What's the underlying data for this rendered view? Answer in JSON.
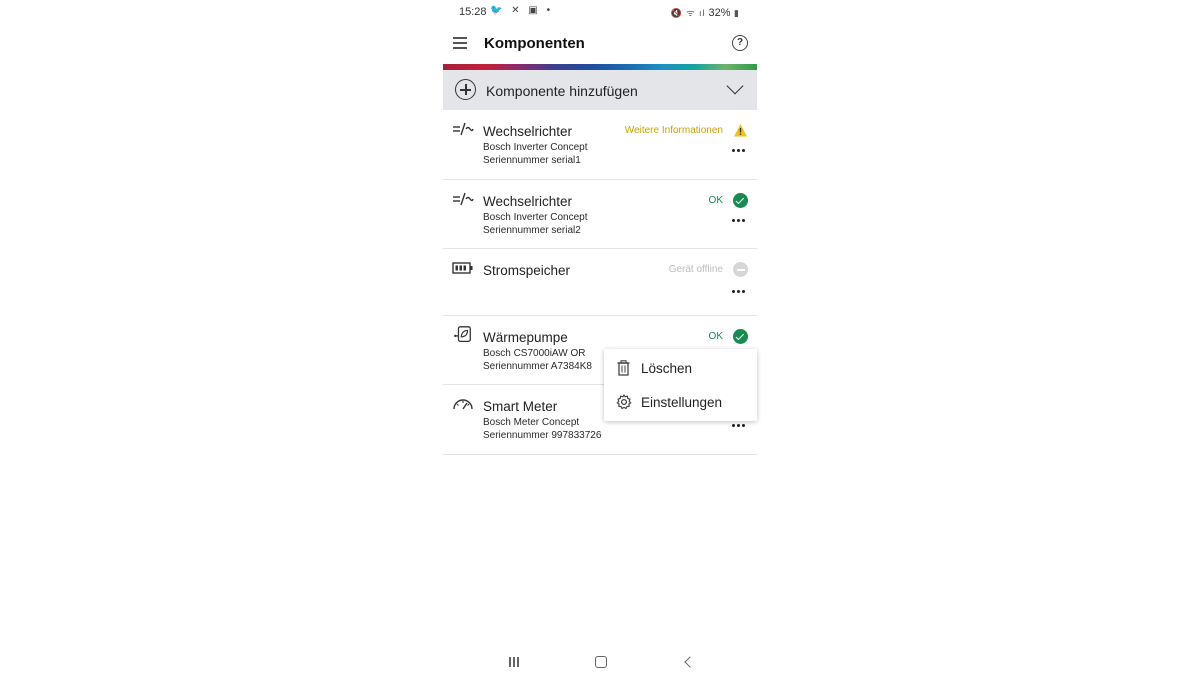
{
  "status_bar": {
    "time": "15:28",
    "left_icons": "🐦 ✕ ▣ •",
    "right_icons": "🔇 ᯤ ıl",
    "battery": "32%"
  },
  "header": {
    "title": "Komponenten",
    "help": "?"
  },
  "add_component": {
    "label": "Komponente hinzufügen"
  },
  "components": [
    {
      "title": "Wechselrichter",
      "line1": "Bosch Inverter Concept",
      "line2": "Seriennummer serial1",
      "status": "Weitere Informationen",
      "status_type": "warning",
      "status_color": "#c9a400"
    },
    {
      "title": "Wechselrichter",
      "line1": "Bosch Inverter Concept",
      "line2": "Seriennummer serial2",
      "status": "OK",
      "status_type": "ok",
      "status_color": "#188a52"
    },
    {
      "title": "Stromspeicher",
      "line1": "",
      "line2": "",
      "status": "Gerät offline",
      "status_type": "offline",
      "status_color": "#bdbdbd"
    },
    {
      "title": "Wärmepumpe",
      "line1": "Bosch CS7000iAW OR",
      "line2": "Seriennummer A7384K8",
      "status": "OK",
      "status_type": "ok",
      "status_color": "#188a52"
    },
    {
      "title": "Smart Meter",
      "line1": "Bosch Meter Concept",
      "line2": "Seriennummer 997833726",
      "status": "",
      "status_type": "none",
      "status_color": "#188a52"
    }
  ],
  "context_menu": {
    "delete_label": "Löschen",
    "settings_label": "Einstellungen"
  }
}
